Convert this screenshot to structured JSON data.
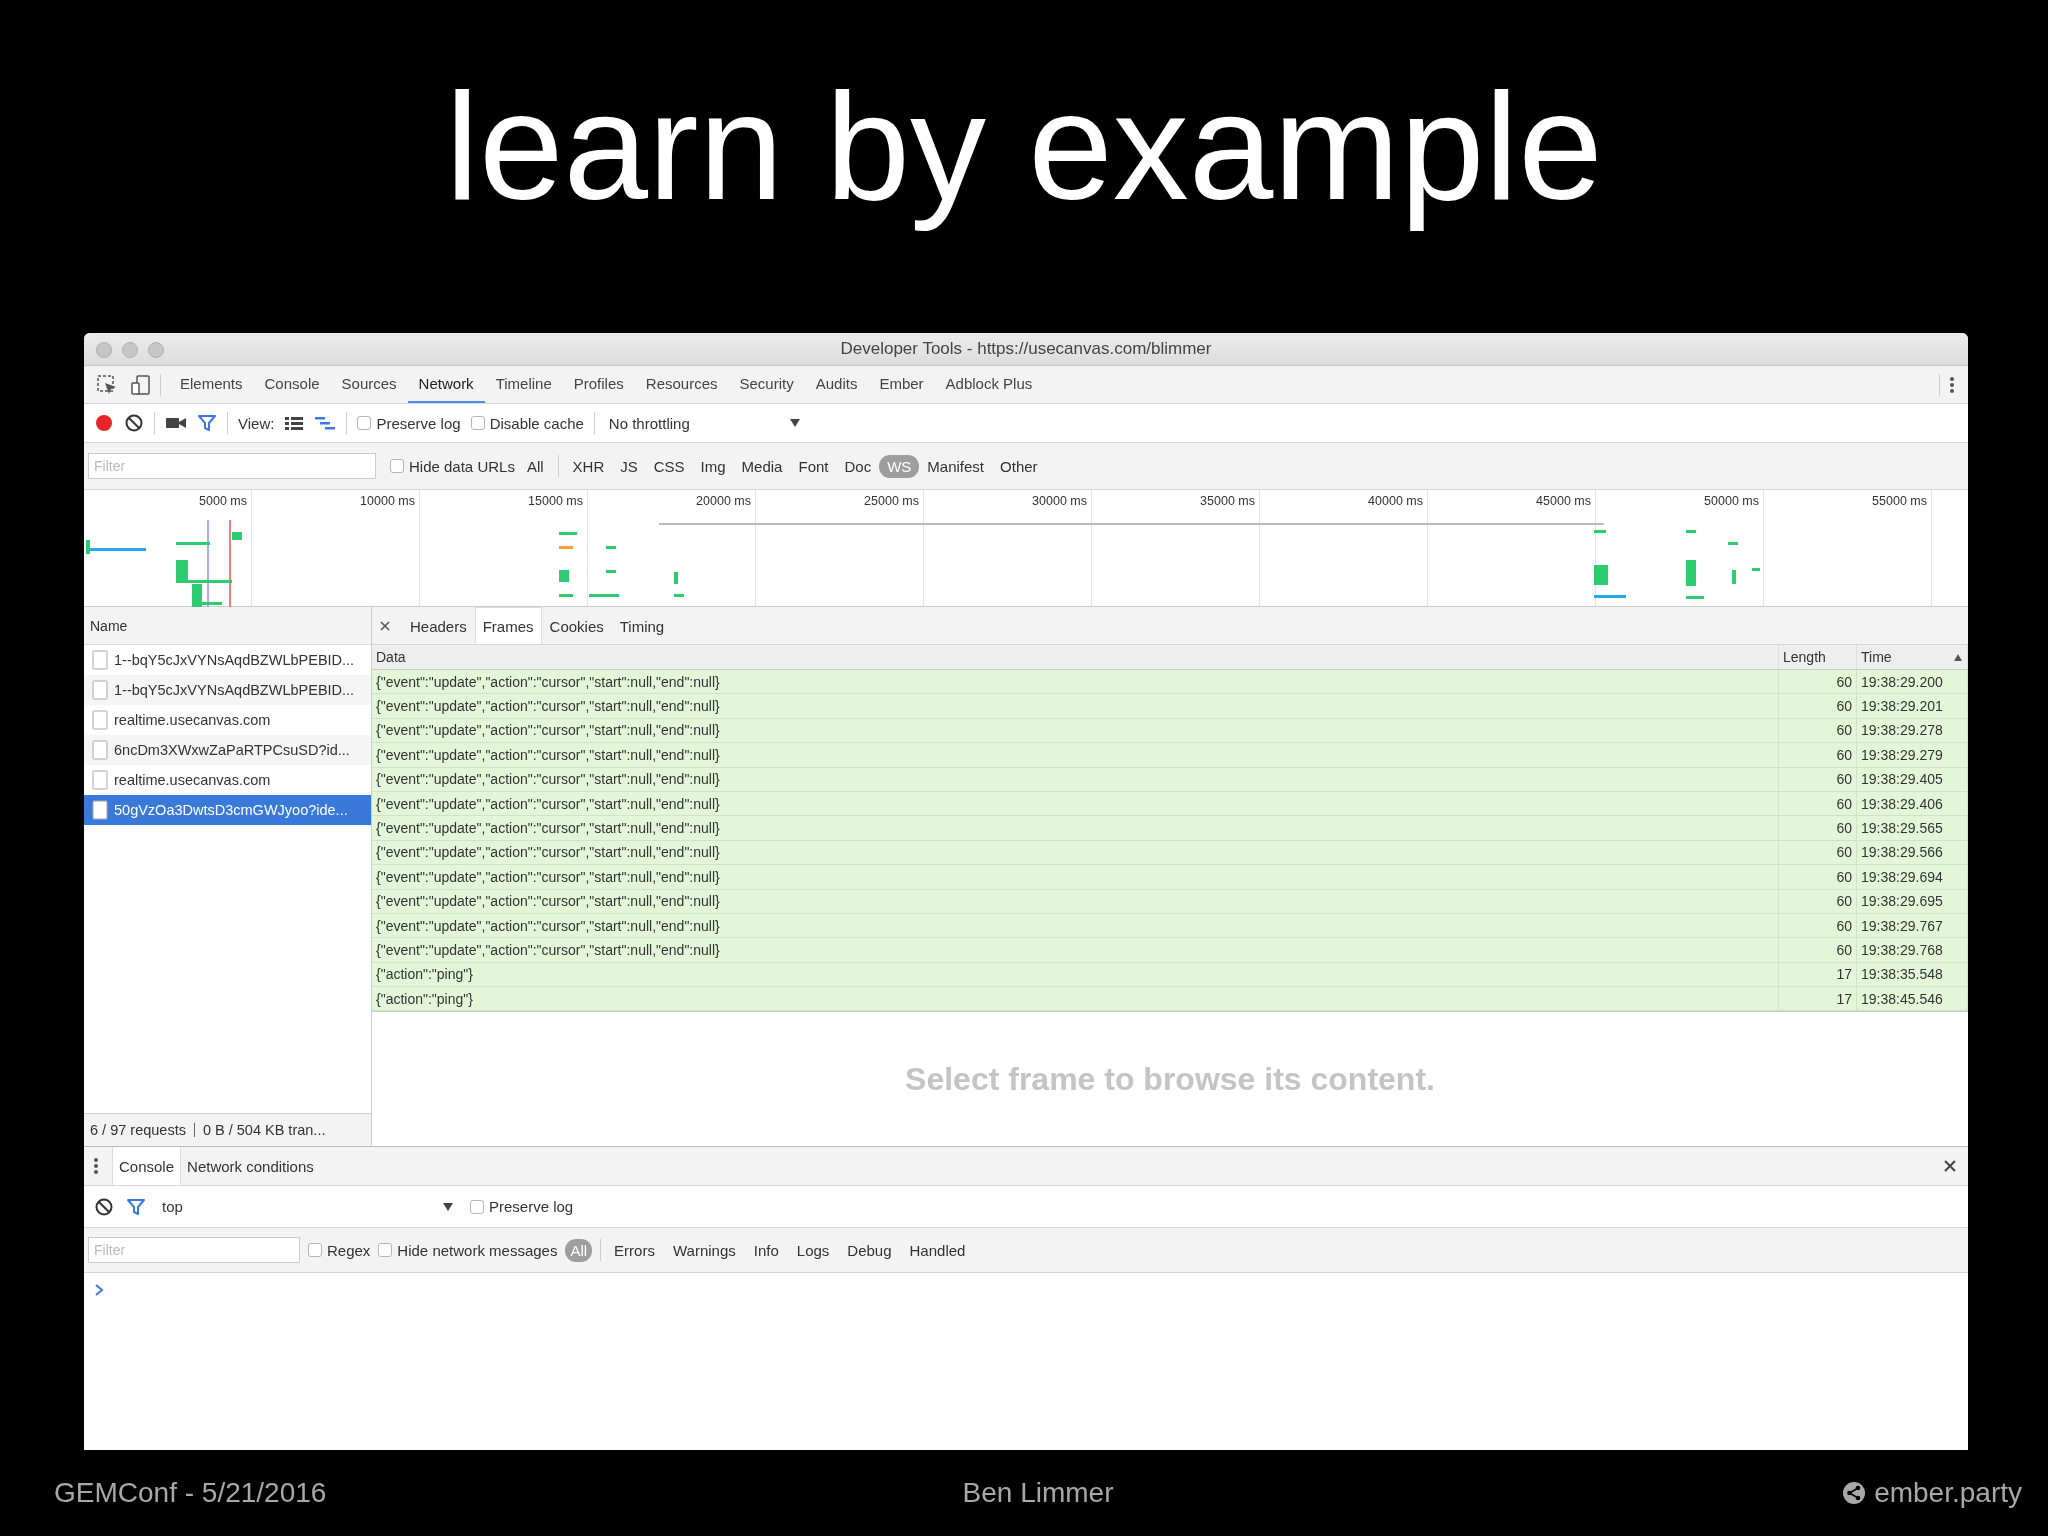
{
  "slide": {
    "title": "learn by example"
  },
  "window": {
    "title": "Developer Tools - https://usecanvas.com/blimmer"
  },
  "panel_tabs": [
    {
      "label": "Elements",
      "selected": false
    },
    {
      "label": "Console",
      "selected": false
    },
    {
      "label": "Sources",
      "selected": false
    },
    {
      "label": "Network",
      "selected": true
    },
    {
      "label": "Timeline",
      "selected": false
    },
    {
      "label": "Profiles",
      "selected": false
    },
    {
      "label": "Resources",
      "selected": false
    },
    {
      "label": "Security",
      "selected": false
    },
    {
      "label": "Audits",
      "selected": false
    },
    {
      "label": "Ember",
      "selected": false
    },
    {
      "label": "Adblock Plus",
      "selected": false
    }
  ],
  "network_toolbar": {
    "recording": true,
    "view_label": "View:",
    "preserve_log": {
      "label": "Preserve log",
      "checked": false
    },
    "disable_cache": {
      "label": "Disable cache",
      "checked": false
    },
    "throttling": "No throttling"
  },
  "filter_bar": {
    "placeholder": "Filter",
    "hide_data_urls": {
      "label": "Hide data URLs",
      "checked": false
    },
    "types": [
      {
        "label": "All",
        "selected": false
      },
      {
        "label": "XHR",
        "selected": false
      },
      {
        "label": "JS",
        "selected": false
      },
      {
        "label": "CSS",
        "selected": false
      },
      {
        "label": "Img",
        "selected": false
      },
      {
        "label": "Media",
        "selected": false
      },
      {
        "label": "Font",
        "selected": false
      },
      {
        "label": "Doc",
        "selected": false
      },
      {
        "label": "WS",
        "selected": true
      },
      {
        "label": "Manifest",
        "selected": false
      },
      {
        "label": "Other",
        "selected": false
      }
    ]
  },
  "timeline": {
    "ticks": [
      "5000 ms",
      "10000 ms",
      "15000 ms",
      "20000 ms",
      "25000 ms",
      "30000 ms",
      "35000 ms",
      "40000 ms",
      "45000 ms",
      "50000 ms",
      "55000 ms"
    ]
  },
  "requests": {
    "column": "Name",
    "items": [
      {
        "name": "1--bqY5cJxVYNsAqdBZWLbPEBID...",
        "selected": false
      },
      {
        "name": "1--bqY5cJxVYNsAqdBZWLbPEBID...",
        "selected": false
      },
      {
        "name": "realtime.usecanvas.com",
        "selected": false
      },
      {
        "name": "6ncDm3XWxwZaPaRTPCsuSD?id...",
        "selected": false
      },
      {
        "name": "realtime.usecanvas.com",
        "selected": false
      },
      {
        "name": "50gVzOa3DwtsD3cmGWJyoo?ide...",
        "selected": true
      }
    ],
    "summary": "6 / 97 requests",
    "transfer": "0 B / 504 KB tran..."
  },
  "detail_tabs": [
    {
      "label": "Headers",
      "selected": false
    },
    {
      "label": "Frames",
      "selected": true
    },
    {
      "label": "Cookies",
      "selected": false
    },
    {
      "label": "Timing",
      "selected": false
    }
  ],
  "frames": {
    "columns": [
      "Data",
      "Length",
      "Time"
    ],
    "rows": [
      {
        "data": "{\"event\":\"update\",\"action\":\"cursor\",\"start\":null,\"end\":null}",
        "length": "60",
        "time": "19:38:29.200"
      },
      {
        "data": "{\"event\":\"update\",\"action\":\"cursor\",\"start\":null,\"end\":null}",
        "length": "60",
        "time": "19:38:29.201"
      },
      {
        "data": "{\"event\":\"update\",\"action\":\"cursor\",\"start\":null,\"end\":null}",
        "length": "60",
        "time": "19:38:29.278"
      },
      {
        "data": "{\"event\":\"update\",\"action\":\"cursor\",\"start\":null,\"end\":null}",
        "length": "60",
        "time": "19:38:29.279"
      },
      {
        "data": "{\"event\":\"update\",\"action\":\"cursor\",\"start\":null,\"end\":null}",
        "length": "60",
        "time": "19:38:29.405"
      },
      {
        "data": "{\"event\":\"update\",\"action\":\"cursor\",\"start\":null,\"end\":null}",
        "length": "60",
        "time": "19:38:29.406"
      },
      {
        "data": "{\"event\":\"update\",\"action\":\"cursor\",\"start\":null,\"end\":null}",
        "length": "60",
        "time": "19:38:29.565"
      },
      {
        "data": "{\"event\":\"update\",\"action\":\"cursor\",\"start\":null,\"end\":null}",
        "length": "60",
        "time": "19:38:29.566"
      },
      {
        "data": "{\"event\":\"update\",\"action\":\"cursor\",\"start\":null,\"end\":null}",
        "length": "60",
        "time": "19:38:29.694"
      },
      {
        "data": "{\"event\":\"update\",\"action\":\"cursor\",\"start\":null,\"end\":null}",
        "length": "60",
        "time": "19:38:29.695"
      },
      {
        "data": "{\"event\":\"update\",\"action\":\"cursor\",\"start\":null,\"end\":null}",
        "length": "60",
        "time": "19:38:29.767"
      },
      {
        "data": "{\"event\":\"update\",\"action\":\"cursor\",\"start\":null,\"end\":null}",
        "length": "60",
        "time": "19:38:29.768"
      },
      {
        "data": "{\"action\":\"ping\"}",
        "length": "17",
        "time": "19:38:35.548"
      },
      {
        "data": "{\"action\":\"ping\"}",
        "length": "17",
        "time": "19:38:45.546"
      }
    ],
    "empty_message": "Select frame to browse its content."
  },
  "drawer": {
    "tabs": [
      {
        "label": "Console",
        "selected": true
      },
      {
        "label": "Network conditions",
        "selected": false
      }
    ],
    "context": "top",
    "preserve_log": {
      "label": "Preserve log",
      "checked": false
    },
    "filter_placeholder": "Filter",
    "regex": {
      "label": "Regex",
      "checked": false
    },
    "hide_network": {
      "label": "Hide network messages",
      "checked": false
    },
    "levels": [
      {
        "label": "All",
        "selected": true
      },
      {
        "label": "Errors",
        "selected": false
      },
      {
        "label": "Warnings",
        "selected": false
      },
      {
        "label": "Info",
        "selected": false
      },
      {
        "label": "Logs",
        "selected": false
      },
      {
        "label": "Debug",
        "selected": false
      },
      {
        "label": "Handled",
        "selected": false
      }
    ]
  },
  "footer": {
    "event": "GEMConf - 5/21/2016",
    "author": "Ben Limmer",
    "site": "ember.party"
  }
}
